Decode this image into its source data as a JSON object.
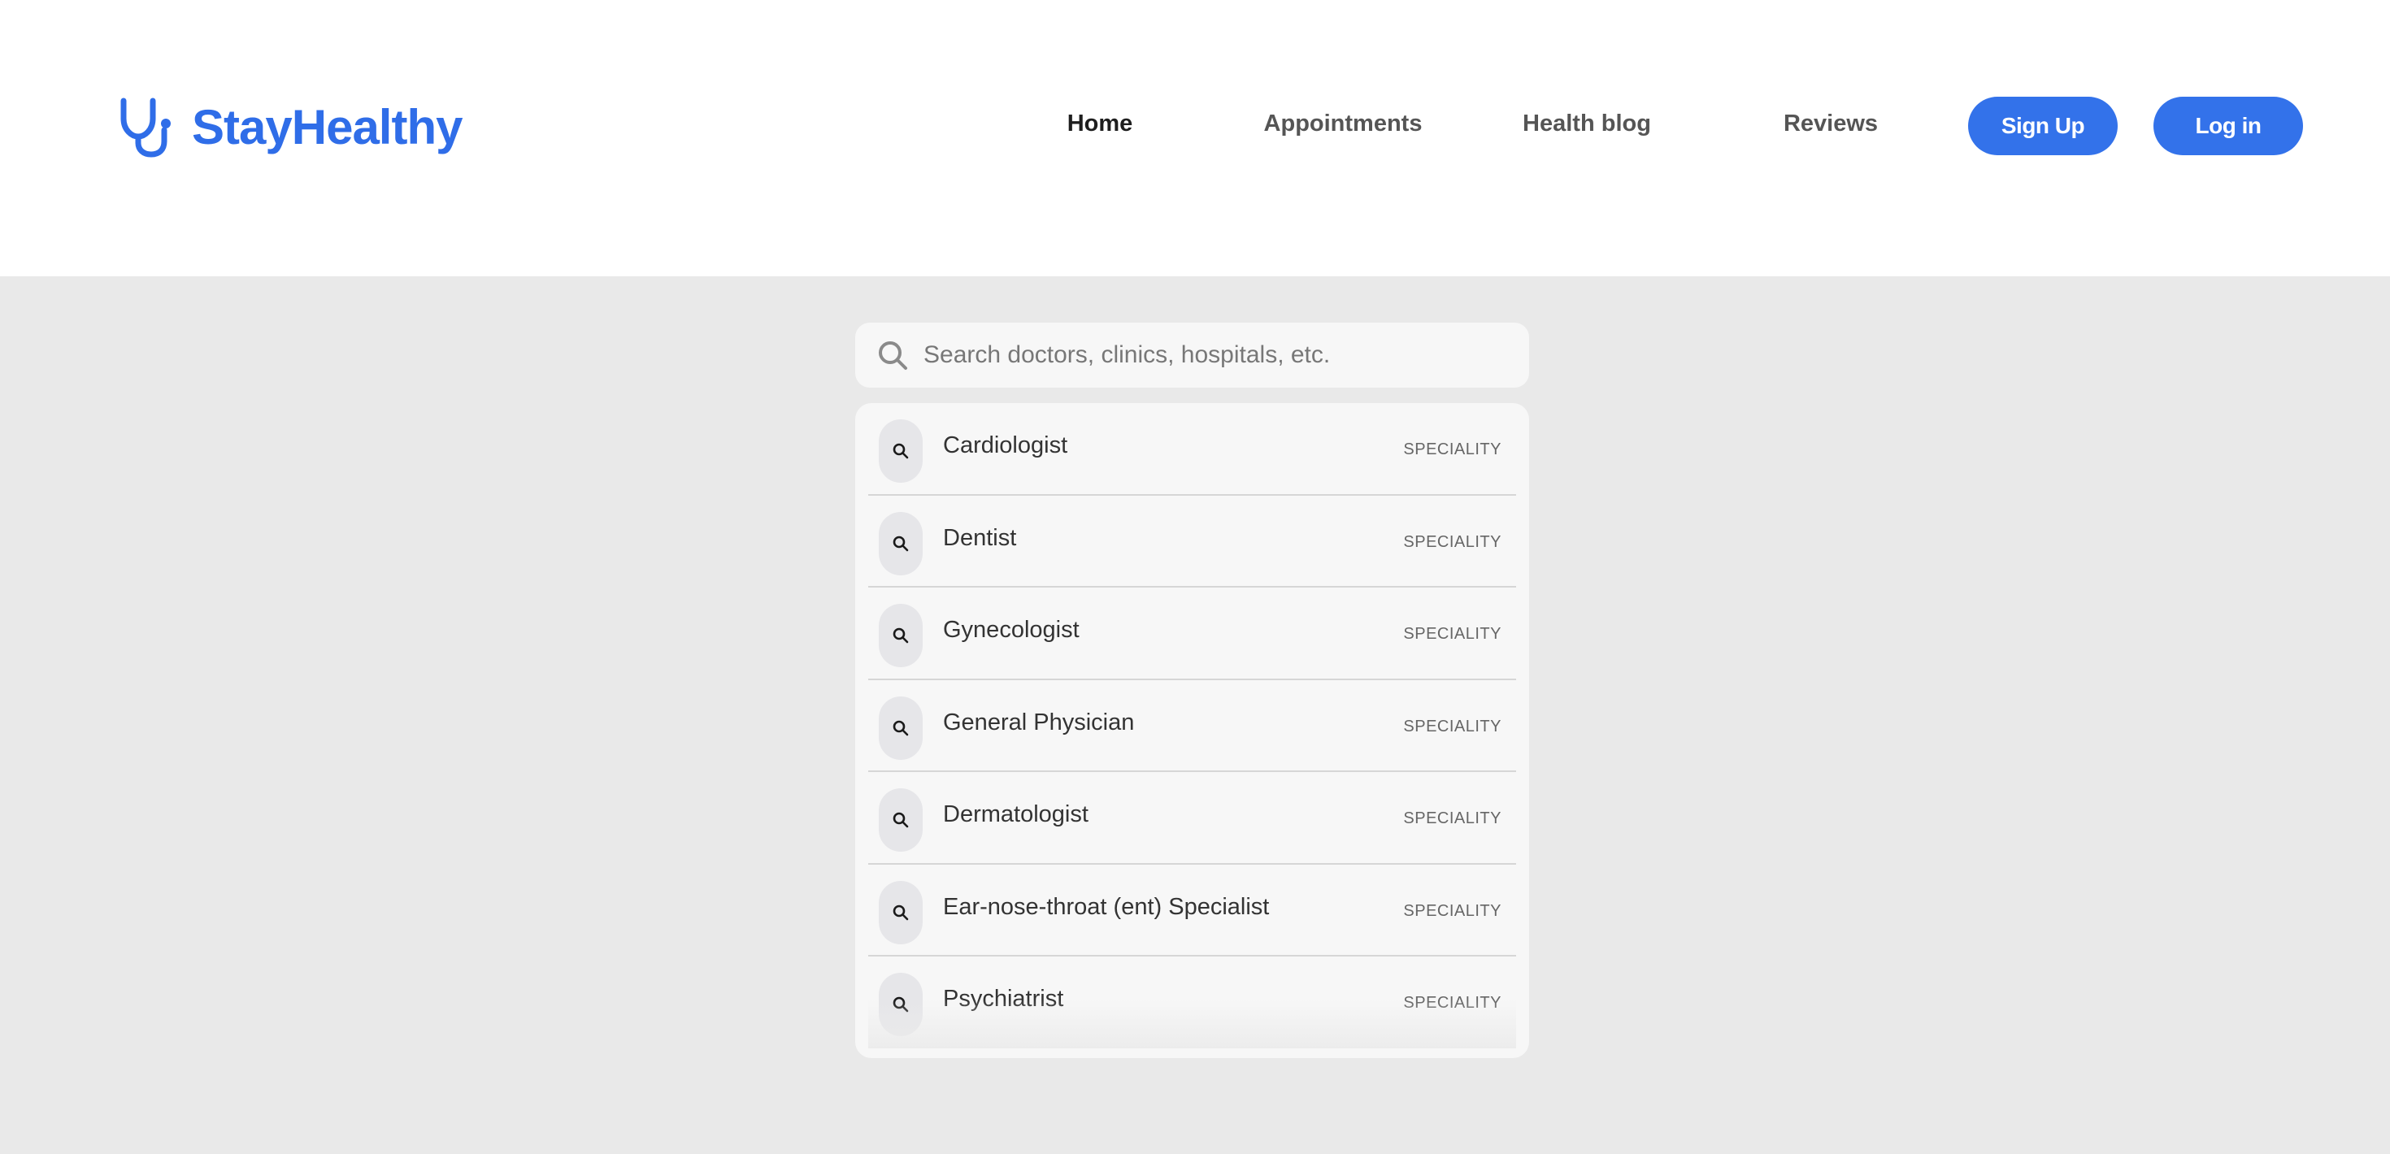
{
  "brand": {
    "name": "StayHealthy",
    "color": "#2f6de8",
    "icon": "stethoscope-icon"
  },
  "nav": {
    "home": "Home",
    "appointments": "Appointments",
    "health_blog": "Health blog",
    "reviews": "Reviews"
  },
  "auth": {
    "signup": "Sign Up",
    "login": "Log in",
    "button_color": "#3372ea"
  },
  "search": {
    "placeholder": "Search doctors, clinics, hospitals, etc.",
    "value": "",
    "icon": "search-icon"
  },
  "results": [
    {
      "label": "Cardiologist",
      "tag": "SPECIALITY"
    },
    {
      "label": "Dentist",
      "tag": "SPECIALITY"
    },
    {
      "label": "Gynecologist",
      "tag": "SPECIALITY"
    },
    {
      "label": "General Physician",
      "tag": "SPECIALITY"
    },
    {
      "label": "Dermatologist",
      "tag": "SPECIALITY"
    },
    {
      "label": "Ear-nose-throat (ent) Specialist",
      "tag": "SPECIALITY"
    },
    {
      "label": "Psychiatrist",
      "tag": "SPECIALITY"
    }
  ]
}
